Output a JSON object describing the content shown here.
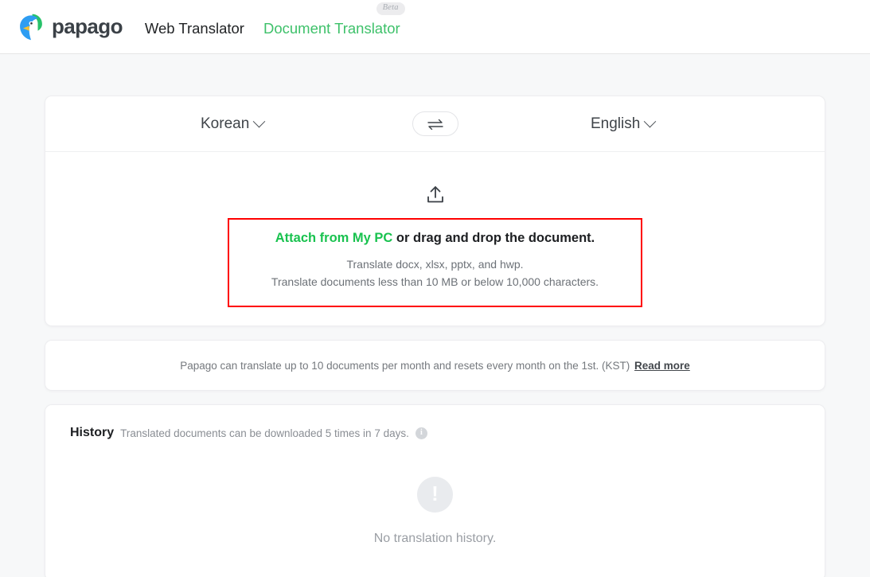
{
  "brand": {
    "name": "papago",
    "logo_icon": "parrot-logo-icon",
    "colors": {
      "green": "#3ec16a",
      "accent_green": "#19c24f",
      "highlight_red": "#ff0000",
      "logo_blue": "#2e9df2",
      "logo_green": "#27c26a",
      "logo_yellow": "#f7c02e"
    }
  },
  "nav": {
    "items": [
      {
        "label": "Web Translator",
        "active": false
      },
      {
        "label": "Document Translator",
        "active": true,
        "badge": "Beta"
      }
    ]
  },
  "translate_card": {
    "language_bar": {
      "source_language": "Korean",
      "target_language": "English",
      "swap_icon": "swap-arrows-icon",
      "chevron_icon": "chevron-down-icon"
    },
    "upload": {
      "icon": "upload-tray-icon",
      "title_link": "Attach from My PC",
      "title_rest": " or drag and drop the document.",
      "subtitle_line_1": "Translate docx, xlsx, pptx, and hwp.",
      "subtitle_line_2": "Translate documents less than 10 MB or below 10,000 characters."
    }
  },
  "notice": {
    "text": "Papago can translate up to 10 documents per month and resets every month on the 1st. (KST)",
    "link_label": "Read more"
  },
  "history": {
    "title": "History",
    "note": "Translated documents can be downloaded 5 times in 7 days.",
    "info_icon": "info-circle-icon",
    "info_glyph": "i",
    "empty": {
      "icon": "exclamation-circle-icon",
      "glyph": "!",
      "message": "No translation history."
    }
  }
}
